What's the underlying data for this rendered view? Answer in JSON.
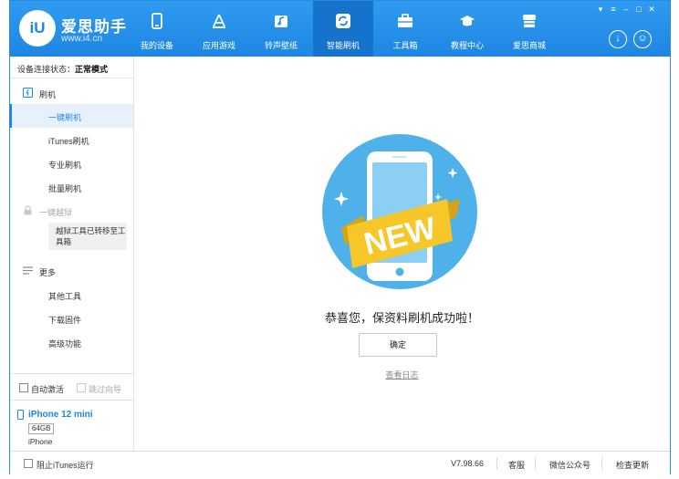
{
  "app": {
    "logo_text": "iU",
    "title": "爱思助手",
    "url": "www.i4.cn"
  },
  "nav": [
    {
      "label": "我的设备",
      "icon": "phone-icon"
    },
    {
      "label": "应用游戏",
      "icon": "app-store-icon"
    },
    {
      "label": "铃声壁纸",
      "icon": "ringtone-icon"
    },
    {
      "label": "智能刷机",
      "icon": "flash-icon",
      "active": true
    },
    {
      "label": "工具箱",
      "icon": "toolbox-icon"
    },
    {
      "label": "教程中心",
      "icon": "tutorial-icon"
    },
    {
      "label": "爱思商城",
      "icon": "store-icon"
    }
  ],
  "window_controls": [
    "▾",
    "≡",
    "–",
    "□",
    "✕"
  ],
  "header_buttons": {
    "download": "↓",
    "user": "☺"
  },
  "sidebar": {
    "status_label": "设备连接状态：",
    "status_value": "正常模式",
    "flash_group": "刷机",
    "flash_items": [
      "一键刷机",
      "iTunes刷机",
      "专业刷机",
      "批量刷机"
    ],
    "jailbreak_group": "一键越狱",
    "jailbreak_note": "越狱工具已转移至工具箱",
    "more_group": "更多",
    "more_items": [
      "其他工具",
      "下载固件",
      "高级功能"
    ],
    "auto_activate": "自动激活",
    "skip_guide": "跳过向导"
  },
  "device": {
    "name": "iPhone 12 mini",
    "storage": "64GB",
    "type": "iPhone"
  },
  "main": {
    "badge_text": "NEW",
    "success_message": "恭喜您，保资料刷机成功啦！",
    "confirm_label": "确定",
    "log_link": "查看日志"
  },
  "bottom": {
    "block_itunes": "阻止iTunes运行",
    "version": "V7.98.66",
    "support": "客服",
    "wechat": "微信公众号",
    "check_update": "检查更新"
  },
  "colors": {
    "brand_blue": "#1e86e3",
    "ribbon_yellow": "#f7c629",
    "circle_blue": "#4fb1ea"
  }
}
